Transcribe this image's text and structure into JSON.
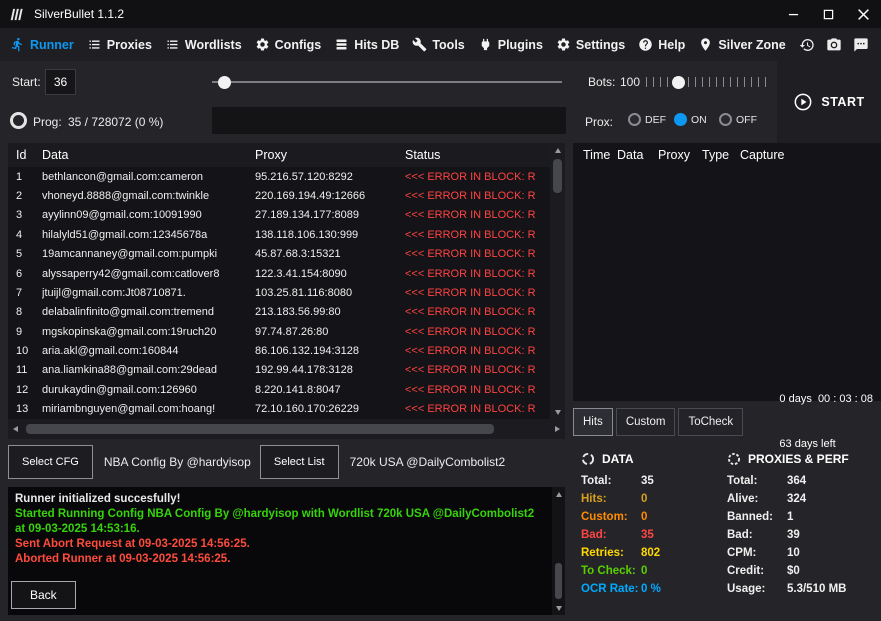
{
  "titlebar": {
    "title": "SilverBullet 1.1.2",
    "icons": [
      "app-logo-icon",
      "minimize-icon",
      "maximize-icon",
      "close-icon"
    ]
  },
  "nav": {
    "items": [
      {
        "label": "Runner",
        "icon": "runner-icon",
        "active": true
      },
      {
        "label": "Proxies",
        "icon": "list-icon"
      },
      {
        "label": "Wordlists",
        "icon": "list-icon"
      },
      {
        "label": "Configs",
        "icon": "gear-icon"
      },
      {
        "label": "Hits DB",
        "icon": "stack-icon"
      },
      {
        "label": "Tools",
        "icon": "wrench-icon"
      },
      {
        "label": "Plugins",
        "icon": "plug-icon"
      },
      {
        "label": "Settings",
        "icon": "gear-icon"
      },
      {
        "label": "Help",
        "icon": "help-icon"
      },
      {
        "label": "Silver Zone",
        "icon": "person-pin-icon"
      }
    ],
    "right_icons": [
      "history-icon",
      "camera-icon",
      "chat-icon",
      "telegram-icon"
    ]
  },
  "controls": {
    "start_label": "Start:",
    "start_value": "36",
    "bots_label": "Bots:",
    "bots_value": "100",
    "start_button_label": "START",
    "prog_label": "Prog:",
    "prog_value": "35 / 728072 (0 %)",
    "prox_label": "Prox:",
    "prox_options": [
      {
        "label": "DEF",
        "selected": false
      },
      {
        "label": "ON",
        "selected": true
      },
      {
        "label": "OFF",
        "selected": false
      }
    ]
  },
  "results_table": {
    "columns": [
      "Id",
      "Data",
      "Proxy",
      "Status"
    ],
    "rows": [
      {
        "id": "1",
        "data": "bethlancon@gmail.com:cameron",
        "proxy": "95.216.57.120:8292",
        "status": "<<< ERROR IN BLOCK: R"
      },
      {
        "id": "2",
        "data": "vhoneyd.8888@gmail.com:twinkle",
        "proxy": "220.169.194.49:12666",
        "status": "<<< ERROR IN BLOCK: R"
      },
      {
        "id": "3",
        "data": "ayylinn09@gmail.com:10091990",
        "proxy": "27.189.134.177:8089",
        "status": "<<< ERROR IN BLOCK: R"
      },
      {
        "id": "4",
        "data": "hilalyld51@gmail.com:12345678a",
        "proxy": "138.118.106.130:999",
        "status": "<<< ERROR IN BLOCK: R"
      },
      {
        "id": "5",
        "data": "19amcannaney@gmail.com:pumpki",
        "proxy": "45.87.68.3:15321",
        "status": "<<< ERROR IN BLOCK: R"
      },
      {
        "id": "6",
        "data": "alyssaperry42@gmail.com:catlover8",
        "proxy": "122.3.41.154:8090",
        "status": "<<< ERROR IN BLOCK: R"
      },
      {
        "id": "7",
        "data": "jtuijl@gmail.com:Jt08710871.",
        "proxy": "103.25.81.116:8080",
        "status": "<<< ERROR IN BLOCK: R"
      },
      {
        "id": "8",
        "data": "delabalinfinito@gmail.com:tremend",
        "proxy": "213.183.56.99:80",
        "status": "<<< ERROR IN BLOCK: R"
      },
      {
        "id": "9",
        "data": "mgskopinska@gmail.com:19ruch20",
        "proxy": "97.74.87.26:80",
        "status": "<<< ERROR IN BLOCK: R"
      },
      {
        "id": "10",
        "data": "aria.akl@gmail.com:160844",
        "proxy": "86.106.132.194:3128",
        "status": "<<< ERROR IN BLOCK: R"
      },
      {
        "id": "11",
        "data": "ana.liamkina88@gmail.com:29dead",
        "proxy": "192.99.44.178:3128",
        "status": "<<< ERROR IN BLOCK: R"
      },
      {
        "id": "12",
        "data": "durukaydin@gmail.com:126960",
        "proxy": "8.220.141.8:8047",
        "status": "<<< ERROR IN BLOCK: R"
      },
      {
        "id": "13",
        "data": "miriambnguyen@gmail.com:hoang!",
        "proxy": "72.10.160.170:26229",
        "status": "<<< ERROR IN BLOCK: R"
      }
    ]
  },
  "hits_table": {
    "columns": [
      "Time",
      "Data",
      "Proxy",
      "Type",
      "Capture"
    ],
    "tabs": [
      "Hits",
      "Custom",
      "ToCheck"
    ],
    "elapsed": "0 days  00 : 03 : 08",
    "remaining": "63 days left"
  },
  "config": {
    "select_cfg_label": "Select CFG",
    "config_name": "NBA Config By @hardyisop",
    "select_list_label": "Select List",
    "wordlist_name": "720k USA @DailyCombolist2"
  },
  "log": {
    "lines": [
      {
        "text": "Runner initialized succesfully!",
        "color": "#e8e8e8"
      },
      {
        "text": "Started Running Config NBA Config By @hardyisop with Wordlist 720k USA @DailyCombolist2 at 09-03-2025 14:53:16.",
        "color": "#36d30a"
      },
      {
        "text": "Sent Abort Request at 09-03-2025 14:56:25.",
        "color": "#ff4b3c"
      },
      {
        "text": "Aborted Runner at 09-03-2025 14:56:25.",
        "color": "#ff4b3c"
      }
    ]
  },
  "back_label": "Back",
  "stats": {
    "data_title": "DATA",
    "data_items": [
      {
        "label": "Total:",
        "value": "35",
        "color": "#f0f0f0"
      },
      {
        "label": "Hits:",
        "value": "0",
        "color": "#d8a020"
      },
      {
        "label": "Custom:",
        "value": "0",
        "color": "#ff8c00"
      },
      {
        "label": "Bad:",
        "value": "35",
        "color": "#ff4545"
      },
      {
        "label": "Retries:",
        "value": "802",
        "color": "#ffd800"
      },
      {
        "label": "To Check:",
        "value": "0",
        "color": "#58d000"
      },
      {
        "label": "OCR Rate:",
        "value": "0 %",
        "color": "#00aaff"
      }
    ],
    "proxies_title": "PROXIES & PERF",
    "proxy_items": [
      {
        "label": "Total:",
        "value": "364",
        "color": "#f0f0f0"
      },
      {
        "label": "Alive:",
        "value": "324",
        "color": "#f0f0f0"
      },
      {
        "label": "Banned:",
        "value": "1",
        "color": "#f0f0f0"
      },
      {
        "label": "Bad:",
        "value": "39",
        "color": "#f0f0f0"
      },
      {
        "label": "CPM:",
        "value": "10",
        "color": "#f0f0f0"
      },
      {
        "label": "Credit:",
        "value": "$0",
        "color": "#f0f0f0"
      },
      {
        "label": "Usage:",
        "value": "5.3/510 MB",
        "color": "#f0f0f0"
      }
    ]
  }
}
